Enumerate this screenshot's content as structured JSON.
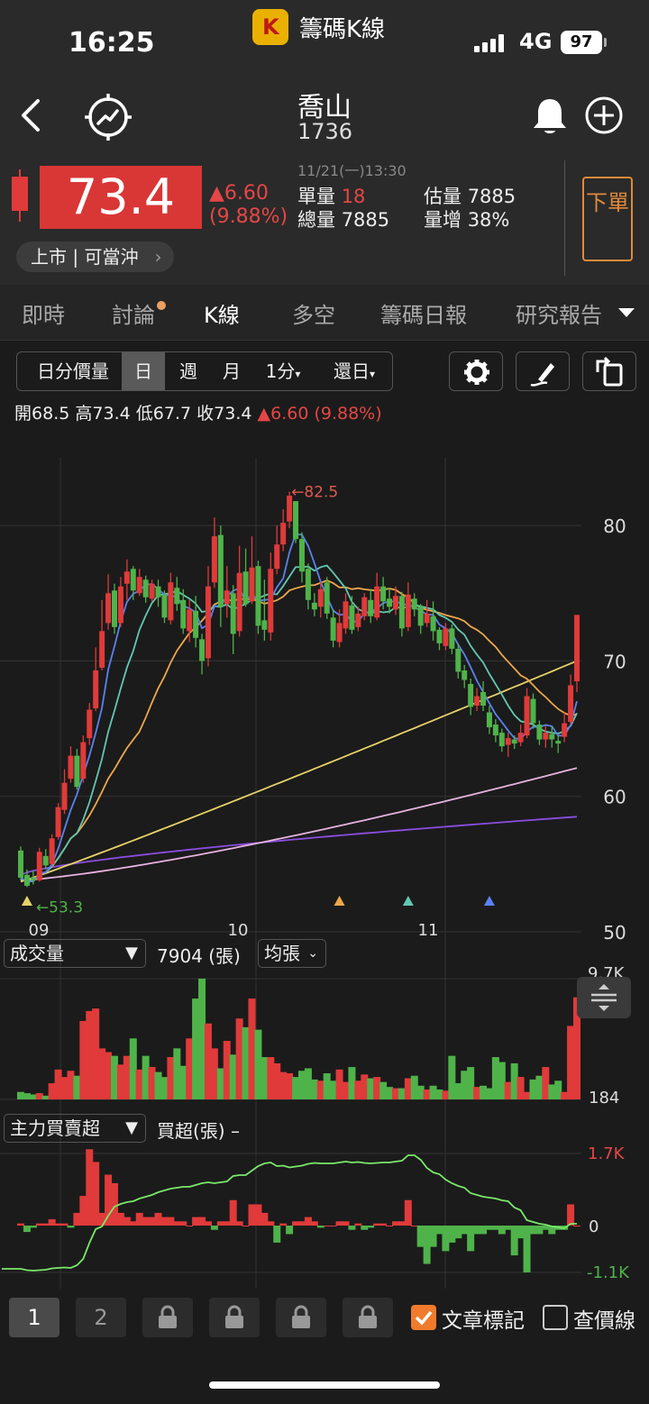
{
  "status_bar": {
    "time": "16:25",
    "app_name": "籌碼K線",
    "network": "4G",
    "battery": "97"
  },
  "header": {
    "stock_name": "喬山",
    "stock_code": "1736"
  },
  "quote": {
    "price": "73.4",
    "change": "▲6.60",
    "change_pct": "(9.88%)",
    "datetime": "11/21(一)13:30",
    "unit_vol_label": "單量",
    "unit_vol": "18",
    "total_vol_label": "總量",
    "total_vol": "7885",
    "est_vol_label": "估量",
    "est_vol": "7885",
    "vol_inc_label": "量增",
    "vol_inc": "38%",
    "market_tag": "上市 | 可當沖",
    "order_button": "下單"
  },
  "tabs": [
    "即時",
    "討論",
    "K線",
    "多空",
    "籌碼日報",
    "研究報告"
  ],
  "toolbar": {
    "items": [
      "日分價量",
      "日",
      "週",
      "月",
      "1分",
      "還日"
    ]
  },
  "ohlc": {
    "open_label": "開",
    "open": "68.5",
    "high_label": "高",
    "high": "73.4",
    "low_label": "低",
    "low": "67.7",
    "close_label": "收",
    "close": "73.4",
    "change": "▲6.60 (9.88%)"
  },
  "panels": {
    "volume_selector": "成交量",
    "volume_value": "7904 (張)",
    "volume_mode": "均張",
    "volume_max_label": "9.7K",
    "volume_min_label": "184",
    "main_force_selector": "主力買賣超",
    "main_force_value": "買超(張) –",
    "mf_top_label": "1.7K",
    "mf_zero_label": "0",
    "mf_bottom_label": "-1.1K"
  },
  "bottom_bar": {
    "pages": [
      "1",
      "2"
    ],
    "article_mark": "文章標記",
    "price_line": "查價線"
  },
  "colors": {
    "up": "#e03a3a",
    "down": "#4fb34a",
    "ma5": "#5b82f0",
    "ma10": "#63c7b0",
    "ma20": "#eda74a",
    "ma60": "#e8d26a",
    "ma120": "#e6b3e0",
    "ma240": "#8a4ee0"
  },
  "chart_data": {
    "type": "candlestick",
    "x_ticks": [
      "09",
      "10",
      "11"
    ],
    "y_ticks": [
      80,
      70,
      60,
      50
    ],
    "ylim": [
      50,
      85
    ],
    "annotations": {
      "high": "←82.5",
      "low": "←53.3"
    },
    "candles": [
      [
        56,
        54,
        56.3,
        53.8
      ],
      [
        54.2,
        53.4,
        54.6,
        53.3
      ],
      [
        54,
        53.8,
        54.5,
        53.5
      ],
      [
        53.8,
        55.9,
        56.2,
        53.7
      ],
      [
        55.6,
        54.9,
        56.1,
        54.6
      ],
      [
        55,
        56.9,
        57.2,
        54.8
      ],
      [
        57,
        59.2,
        59.5,
        56.8
      ],
      [
        59,
        61,
        62,
        58.7
      ],
      [
        61.3,
        63,
        63.7,
        61
      ],
      [
        63,
        60.7,
        63.5,
        60.5
      ],
      [
        61.3,
        64,
        64.5,
        61
      ],
      [
        64.3,
        66.4,
        66.9,
        63.8
      ],
      [
        66.5,
        69.3,
        71,
        66.3
      ],
      [
        69.5,
        72.2,
        74.5,
        69.3
      ],
      [
        72.8,
        75,
        76.4,
        72.3
      ],
      [
        75.2,
        72.5,
        75.7,
        72
      ],
      [
        72.8,
        75.5,
        76.2,
        72.5
      ],
      [
        75.7,
        76.6,
        77.5,
        74.5
      ],
      [
        76.8,
        75.2,
        77,
        74.5
      ],
      [
        75,
        76.2,
        76.8,
        74.8
      ],
      [
        76,
        74.7,
        76.3,
        74.3
      ],
      [
        74.6,
        75.7,
        76,
        74.4
      ],
      [
        75.5,
        74.7,
        76,
        74
      ],
      [
        74.9,
        73.2,
        75.2,
        72.8
      ],
      [
        73,
        75.8,
        76.5,
        72.7
      ],
      [
        75.4,
        74.2,
        76.2,
        73.7
      ],
      [
        74.5,
        72.4,
        75.3,
        72
      ],
      [
        72.2,
        73.8,
        74.5,
        71.4
      ],
      [
        73.7,
        71.7,
        74.8,
        71
      ],
      [
        71.6,
        70,
        72,
        69
      ],
      [
        70.2,
        75.5,
        77,
        69.6
      ],
      [
        75.8,
        79.2,
        80.6,
        75.4
      ],
      [
        79.3,
        74,
        80,
        72.5
      ],
      [
        74.2,
        75.2,
        77,
        73.2
      ],
      [
        75,
        72,
        75.6,
        70.5
      ],
      [
        72.2,
        76.5,
        78.5,
        71.8
      ],
      [
        76.6,
        74.2,
        78.3,
        74
      ],
      [
        74.4,
        76.9,
        79.2,
        74.2
      ],
      [
        77,
        72.6,
        77.4,
        72
      ],
      [
        73,
        72.3,
        76,
        71.5
      ],
      [
        72.1,
        76.8,
        78,
        71.5
      ],
      [
        76.8,
        78.6,
        80,
        76.4
      ],
      [
        78.6,
        80.2,
        81.2,
        78.1
      ],
      [
        80.3,
        82.2,
        82.5,
        79.8
      ],
      [
        81.8,
        79,
        81.8,
        78.7
      ],
      [
        79,
        76.6,
        79.5,
        75.8
      ],
      [
        76.8,
        74.5,
        77.2,
        73.8
      ],
      [
        74.3,
        73.8,
        75,
        73.3
      ],
      [
        74,
        75.3,
        75.8,
        73.2
      ],
      [
        75.8,
        73.5,
        76.2,
        73.1
      ],
      [
        73.2,
        71.5,
        73.8,
        71
      ],
      [
        71.4,
        72.8,
        73.8,
        71
      ],
      [
        72.4,
        74.4,
        75,
        72
      ],
      [
        74.1,
        72.3,
        74.8,
        72
      ],
      [
        72.5,
        73.5,
        74,
        72.2
      ],
      [
        73.3,
        74.7,
        75,
        73
      ],
      [
        74.5,
        73.3,
        75.3,
        72.8
      ],
      [
        73.2,
        75.5,
        76.5,
        73
      ],
      [
        75.5,
        74.4,
        76.2,
        73.8
      ],
      [
        74.6,
        74,
        75.4,
        73.5
      ],
      [
        73.8,
        74.8,
        75.5,
        73.4
      ],
      [
        74.8,
        72.4,
        75.1,
        71.8
      ],
      [
        72.5,
        74.9,
        75.8,
        72.2
      ],
      [
        74.6,
        73.8,
        75,
        73.3
      ],
      [
        74,
        72.6,
        74.2,
        72
      ],
      [
        72.8,
        73.5,
        74.5,
        72.5
      ],
      [
        73.3,
        72.2,
        74.4,
        71.5
      ],
      [
        72.3,
        71.3,
        72.5,
        70.8
      ],
      [
        71.1,
        72.4,
        72.8,
        70.8
      ],
      [
        72.4,
        70.9,
        72.7,
        70.5
      ],
      [
        70.9,
        69.2,
        71.3,
        68.7
      ],
      [
        69.3,
        68.6,
        69.7,
        68
      ],
      [
        68.3,
        66.6,
        68.7,
        66
      ],
      [
        66.7,
        67.4,
        68,
        66.3
      ],
      [
        67.7,
        66.7,
        68.5,
        66.3
      ],
      [
        66.2,
        65.1,
        66.7,
        64.6
      ],
      [
        65.3,
        64.5,
        65.7,
        64
      ],
      [
        64.7,
        63.7,
        65,
        63.3
      ],
      [
        63.8,
        64.3,
        64.7,
        62.9
      ],
      [
        64.2,
        63.9,
        64.5,
        63.5
      ],
      [
        64,
        64.7,
        65.3,
        63.7
      ],
      [
        64.5,
        67.4,
        68,
        64.3
      ],
      [
        67.2,
        65.4,
        67.6,
        65
      ],
      [
        65.3,
        64.2,
        65.6,
        63.8
      ],
      [
        64.2,
        64.7,
        65.2,
        63.6
      ],
      [
        64.6,
        64.2,
        65.2,
        63.6
      ],
      [
        64.1,
        63.9,
        64.5,
        63.2
      ],
      [
        64.4,
        65.4,
        66.2,
        64
      ],
      [
        65.5,
        68.2,
        69,
        65.3
      ],
      [
        68.5,
        73.4,
        73.4,
        67.7
      ]
    ],
    "volume": [
      0.6,
      0.5,
      0.4,
      0.5,
      0.3,
      1.3,
      2.4,
      1.8,
      2.3,
      1.9,
      6.3,
      7.1,
      7.3,
      4.1,
      3.8,
      3.5,
      2.8,
      3.5,
      4.9,
      2.4,
      3.5,
      2.6,
      2.2,
      1.8,
      3.4,
      4.1,
      2.7,
      4.9,
      8.1,
      9.7,
      6.1,
      4.1,
      2.5,
      4.7,
      3.6,
      6.5,
      5.8,
      8.1,
      5.6,
      3.4,
      3.4,
      2.9,
      2.2,
      2.1,
      1.8,
      2.3,
      2.5,
      1.6,
      1.5,
      2.1,
      1.5,
      2.4,
      1.4,
      2.6,
      1.5,
      2.0,
      1.7,
      1.8,
      1.4,
      1.0,
      0.9,
      0.9,
      1.7,
      1.9,
      1.1,
      0.8,
      1.1,
      0.8,
      0.7,
      3.5,
      1.3,
      2.3,
      2.6,
      1.0,
      1.1,
      0.9,
      3.4,
      3.0,
      1.4,
      2.9,
      1.8,
      0.6,
      1.6,
      1.9,
      2.6,
      1.2,
      1.5,
      0.6,
      5.9,
      8.2
    ],
    "main_force": [
      0.05,
      -0.15,
      -0.05,
      0.05,
      0.05,
      0.15,
      0.05,
      0.05,
      -0.05,
      0.3,
      0.7,
      1.8,
      1.5,
      0.3,
      1.2,
      1.0,
      0.3,
      0.2,
      0.1,
      0.3,
      0.2,
      0.2,
      0.3,
      0.2,
      0.2,
      0.1,
      0.1,
      0.0,
      0.2,
      0.2,
      0.1,
      -0.1,
      0.1,
      0.1,
      0.6,
      0.1,
      0.0,
      0.5,
      0.5,
      0.3,
      0.1,
      -0.4,
      0.05,
      -0.2,
      0.1,
      0.1,
      0.2,
      0.1,
      -0.05,
      0.0,
      0.0,
      0.1,
      0.1,
      -0.1,
      0.05,
      -0.1,
      -0.05,
      0.05,
      0.05,
      0.0,
      0.1,
      0.1,
      0.6,
      0.0,
      -0.5,
      -0.9,
      -0.5,
      -0.2,
      -0.6,
      -0.4,
      -0.3,
      -0.2,
      -0.6,
      -0.2,
      -0.2,
      -0.1,
      -0.1,
      -0.2,
      -0.1,
      -0.7,
      -0.3,
      -1.1,
      -0.2,
      -0.2,
      -0.1,
      -0.2,
      -0.1,
      -0.1,
      0.5,
      0.0
    ],
    "markers": [
      {
        "index": 1,
        "color": "#e8d26a"
      },
      {
        "index": 51,
        "color": "#eda74a"
      },
      {
        "index": 62,
        "color": "#63c7b0"
      },
      {
        "index": 75,
        "color": "#5b82f0"
      }
    ]
  }
}
